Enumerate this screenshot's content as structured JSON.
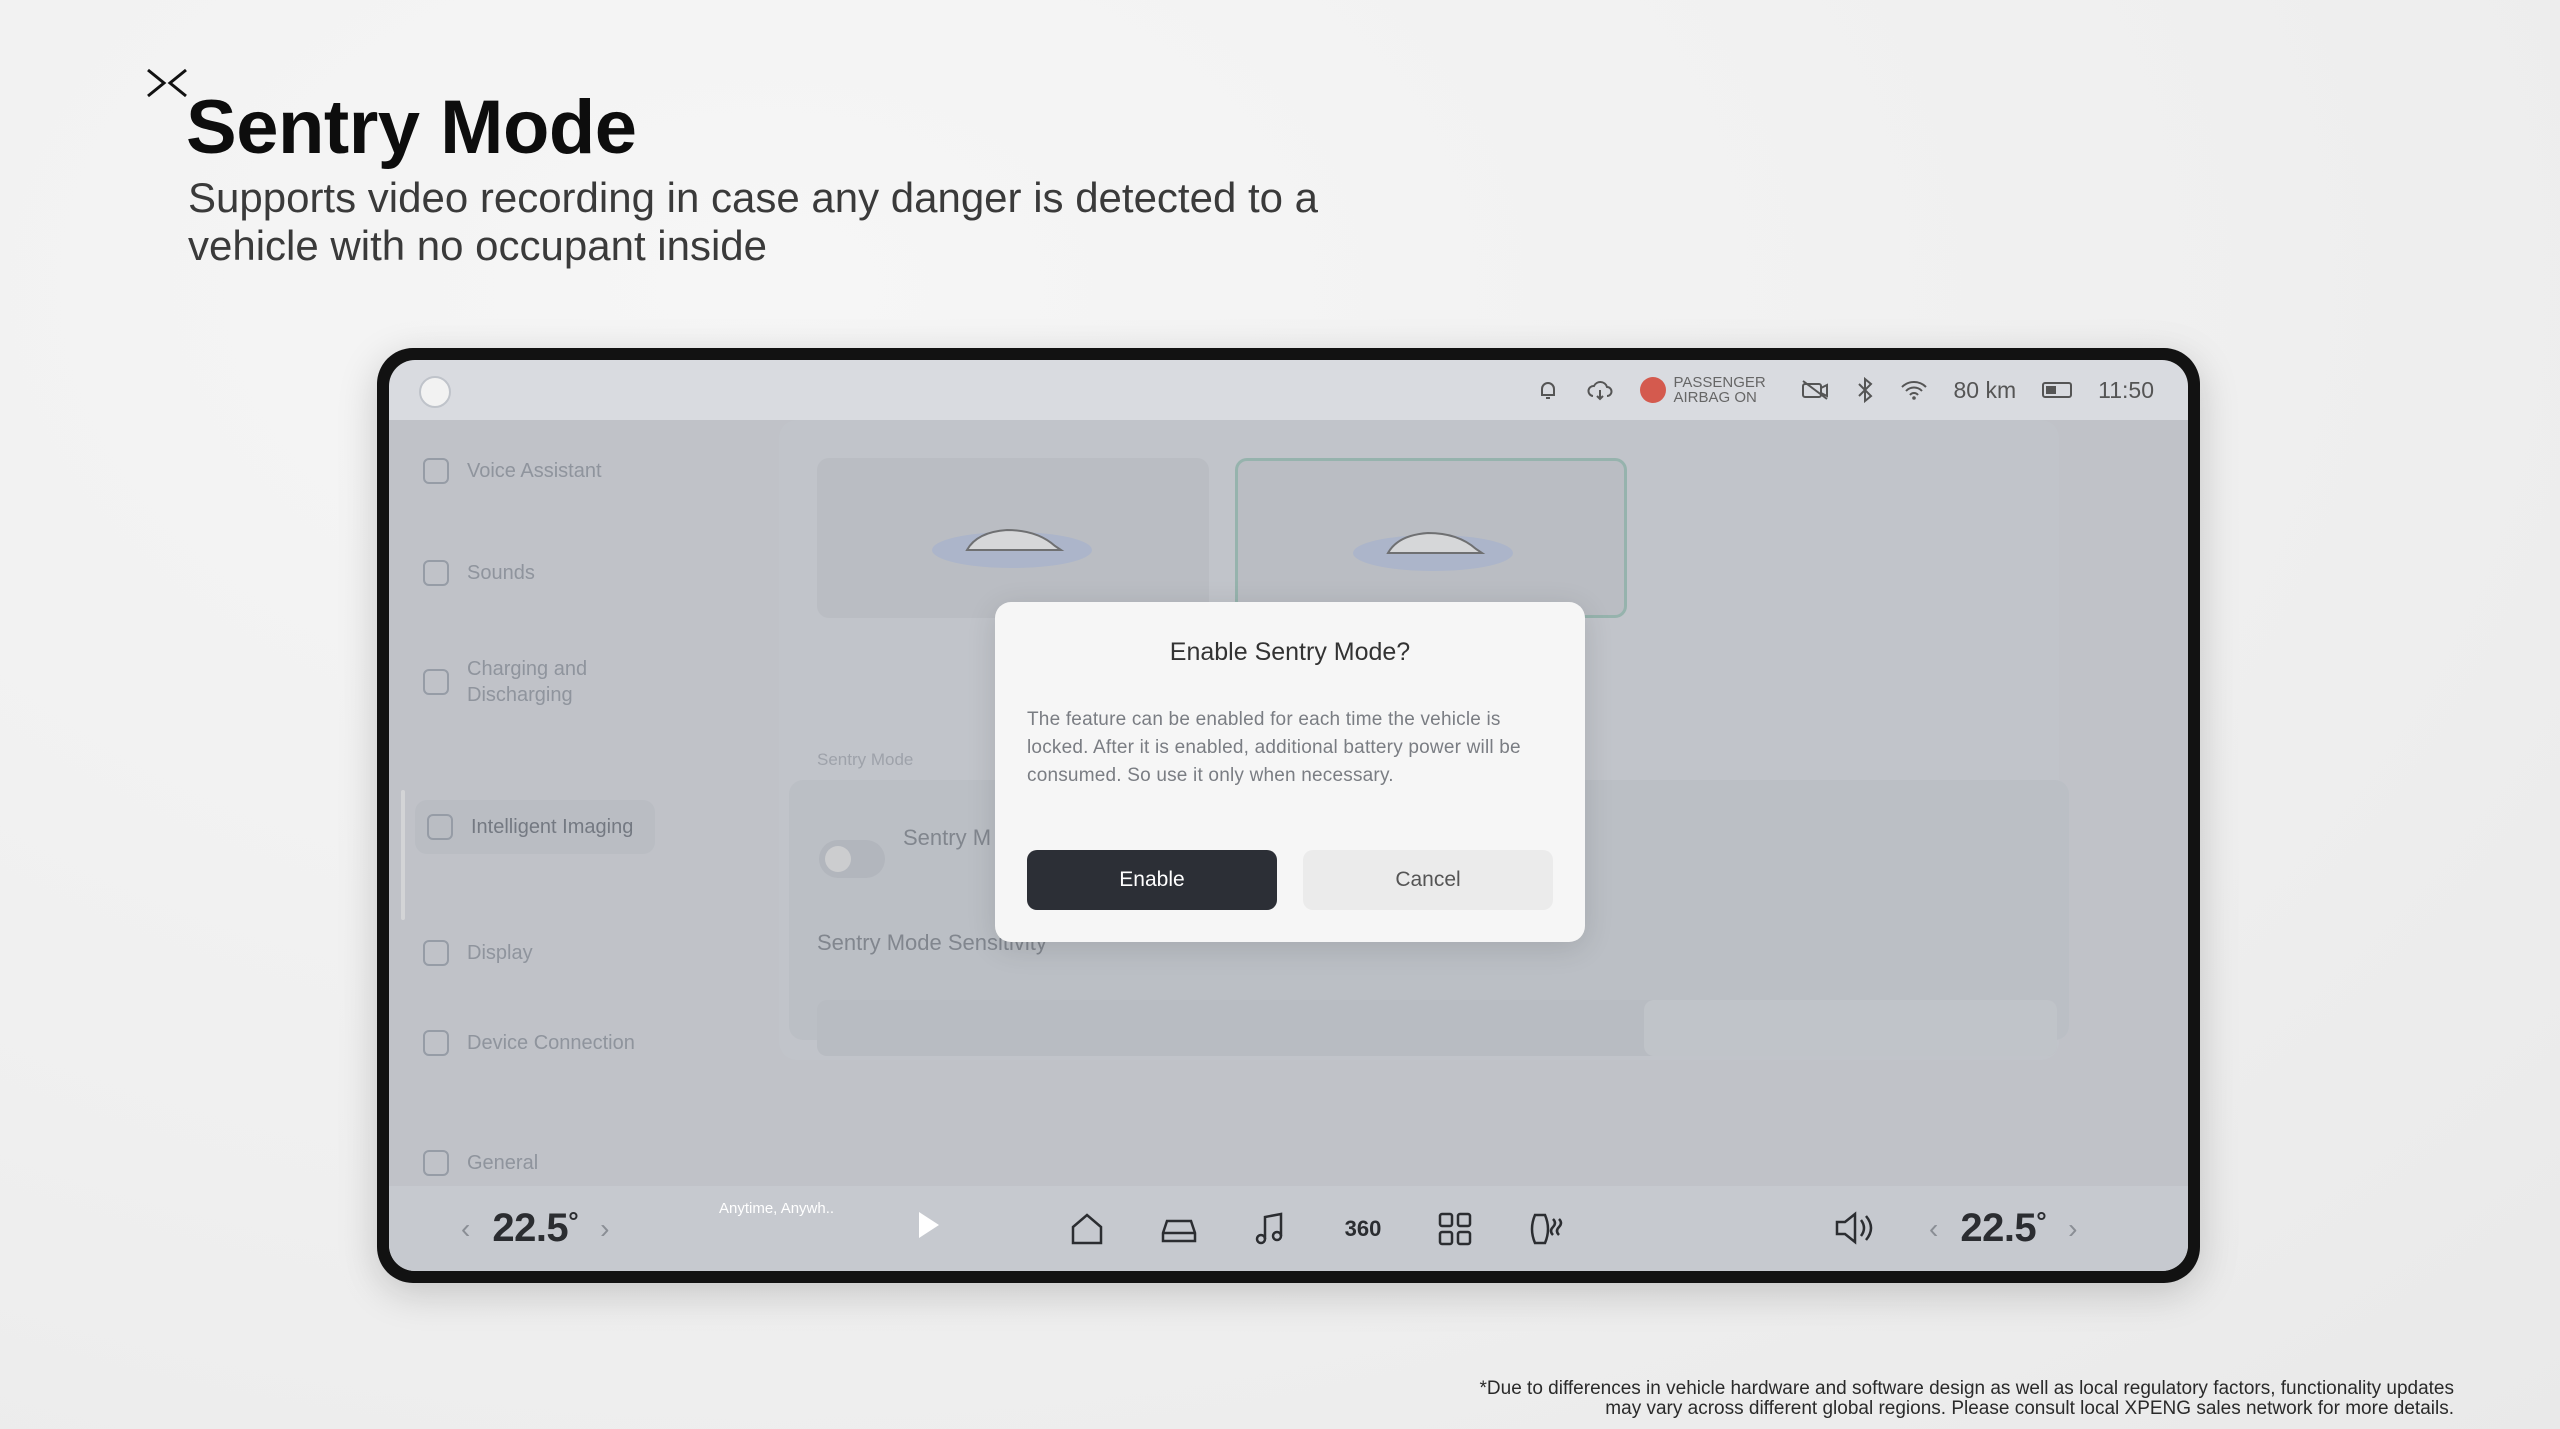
{
  "slide": {
    "title": "Sentry Mode",
    "subtitle": "Supports video recording in case any danger is detected to a vehicle with no occupant inside",
    "footnote": "*Due to differences in vehicle hardware and software design as well as local regulatory factors, functionality updates may vary across different global regions. Please consult local XPENG sales network for more details.",
    "brand_icon": "xpeng-logo-icon"
  },
  "status_bar": {
    "airbag_text": "PASSENGER AIRBAG ON",
    "range": "80 km",
    "time": "11:50",
    "icons": [
      "bell-icon",
      "cloud-download-icon",
      "airbag-icon",
      "camera-off-icon",
      "bluetooth-icon",
      "wifi-icon",
      "battery-icon"
    ]
  },
  "sidebar": {
    "items": [
      {
        "label": "Voice Assistant",
        "icon": "microphone-icon"
      },
      {
        "label": "Sounds",
        "icon": "speaker-icon"
      },
      {
        "label": "Charging and Discharging",
        "icon": "lightning-icon"
      },
      {
        "label": "Intelligent Imaging",
        "icon": "camera-icon",
        "active": true
      },
      {
        "label": "Display",
        "icon": "sun-icon"
      },
      {
        "label": "Device Connection",
        "icon": "link-icon"
      },
      {
        "label": "General",
        "icon": "settings-icon"
      }
    ]
  },
  "background": {
    "section_label": "Sentry Mode",
    "row_title": "Sentry M",
    "sensitivity_title": "Sentry Mode Sensitivity"
  },
  "dialog": {
    "title": "Enable Sentry Mode?",
    "body": "The feature can be enabled for each time the vehicle is locked. After it is enabled, additional battery power will be consumed. So use it only when necessary.",
    "enable_label": "Enable",
    "cancel_label": "Cancel"
  },
  "dock": {
    "left_temp": "22.5",
    "right_temp": "22.5",
    "degree": "°",
    "media_title": "Anytime, Anywh..",
    "icons": [
      "home-icon",
      "car-icon",
      "music-icon",
      "camera-360-icon",
      "apps-grid-icon",
      "seat-heater-icon",
      "volume-icon"
    ],
    "cam_label": "360"
  }
}
